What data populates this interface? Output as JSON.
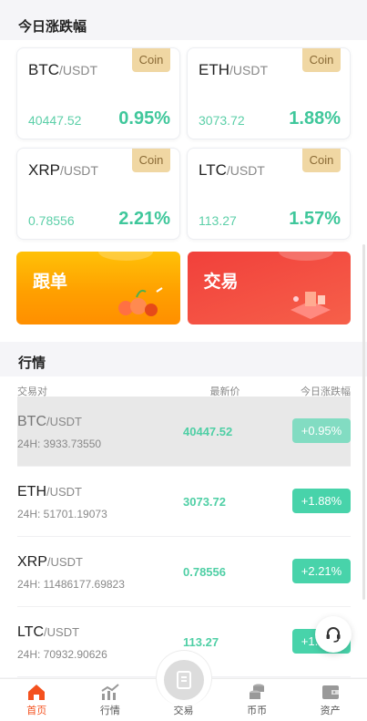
{
  "today_title": "今日涨跌幅",
  "coin_tag": "Coin",
  "coins": [
    {
      "base": "BTC",
      "quote": "/USDT",
      "price": "40447.52",
      "change": "0.95%"
    },
    {
      "base": "ETH",
      "quote": "/USDT",
      "price": "3073.72",
      "change": "1.88%"
    },
    {
      "base": "XRP",
      "quote": "/USDT",
      "price": "0.78556",
      "change": "2.21%"
    },
    {
      "base": "LTC",
      "quote": "/USDT",
      "price": "113.27",
      "change": "1.57%"
    }
  ],
  "banners": {
    "follow": "跟单",
    "trade": "交易"
  },
  "market": {
    "title": "行情",
    "col_pair": "交易对",
    "col_price": "最新价",
    "col_change": "今日涨跌幅",
    "rows": [
      {
        "base": "BTC",
        "quote": "/USDT",
        "vol": "24H: 3933.73550",
        "price": "40447.52",
        "change": "+0.95%"
      },
      {
        "base": "ETH",
        "quote": "/USDT",
        "vol": "24H: 51701.19073",
        "price": "3073.72",
        "change": "+1.88%"
      },
      {
        "base": "XRP",
        "quote": "/USDT",
        "vol": "24H: 11486177.69823",
        "price": "0.78556",
        "change": "+2.21%"
      },
      {
        "base": "LTC",
        "quote": "/USDT",
        "vol": "24H: 70932.90626",
        "price": "113.27",
        "change": "+1.57%"
      }
    ]
  },
  "tabs": {
    "home": "首页",
    "market": "行情",
    "trade": "交易",
    "coin": "币币",
    "assets": "资产"
  },
  "colors": {
    "accent": "#f4511e",
    "up": "#48d3aa",
    "coin_tag": "#f0d7a3"
  }
}
